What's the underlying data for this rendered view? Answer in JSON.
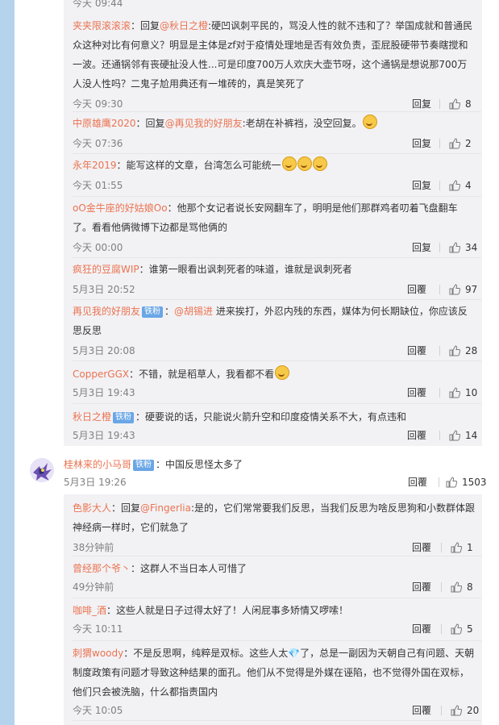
{
  "top_cut": {
    "time": "今天 09:44"
  },
  "comments": [
    {
      "user": "夹夹限滚滚滚",
      "prefix": "：回复",
      "mention": "@秋日之橙",
      "text": ":硬凹讽刺平民的，骂没人性的就不违和了？举国成就和普通民众这种对比有何意义？明显是主体是zf对于疫情处理地是否有效负责，歪屁股硬带节奏瞎搅和一波。还通锅邻有丧硬扯没人性...可是印度700万人欢庆大壶节呀，这个通锅是想说那700万人没人性吗？二鬼子尬用典还有一堆砖的，真是笑死了",
      "time": "今天 09:30",
      "reply_label": "回复",
      "likes": "8"
    },
    {
      "user": "中原雄鹰2020",
      "prefix": "：回复",
      "mention": "@再见我的好朋友",
      "text": ":老胡在补裤裆，没空回复。",
      "time": "今天 07:36",
      "reply_label": "回复",
      "likes": "2"
    },
    {
      "user": "永年2019",
      "text": "：能写这样的文章，台湾怎么可能统一",
      "time": "今天 01:55",
      "reply_label": "回复",
      "likes": "4"
    },
    {
      "user": "oO金牛座的好姑娘Oo",
      "text": "：他那个女记者说长安网翻车了，明明是他们那群鸡者叨着飞盘翻车了。看看他俩微博下边都是骂他俩的",
      "time": "今天 00:00",
      "reply_label": "回复",
      "likes": "34"
    },
    {
      "user": "疯狂的豆腐WIP",
      "text": "：谁第一眼看出讽刺死者的味道，谁就是讽刺死者",
      "time": "5月3日 20:52",
      "reply_label": "回覆",
      "likes": "97"
    },
    {
      "user": "再见我的好朋友",
      "tag": "铁粉",
      "prefix": "：",
      "mention": "@胡锡进",
      "text": " 进来挨打，外忍内残的东西，媒体为何长期缺位，你应该反思反思",
      "time": "5月3日 20:08",
      "reply_label": "回覆",
      "likes": "28"
    },
    {
      "user": "CopperGGX",
      "text": "：不错，就是稻草人，我看都不看",
      "time": "5月3日 19:43",
      "reply_label": "回覆",
      "likes": "10"
    },
    {
      "user": "秋日之橙",
      "tag": "铁粉",
      "text": "：硬要说的话，只能说火箭升空和印度疫情关系不大，有点违和",
      "time": "5月3日 19:43",
      "reply_label": "回覆",
      "likes": "14"
    }
  ],
  "main_comment": {
    "user": "桂林来的小马哥",
    "tag": "铁粉",
    "text": "：中国反思怪太多了",
    "time": "5月3日 19:26",
    "reply_label": "回覆",
    "likes": "1503"
  },
  "sub_comments": [
    {
      "user": "色影大人",
      "prefix": "：回复",
      "mention": "@Fingerlia",
      "text": ":是的，它们常常要我们反思，当我们反思为啥反思狗和小数群体跟神经病一样时，它们就急了",
      "time": "38分钟前",
      "reply_label": "回覆",
      "likes": "1"
    },
    {
      "user": "曾经那个爷丶",
      "text": "：这群人不当日本人可惜了",
      "time": "49分钟前",
      "reply_label": "回覆",
      "likes": "8"
    },
    {
      "user": "咖啡_酒",
      "text": "：这些人就是日子过得太好了！人闲屁事多矫情又啰嗦！",
      "time": "今天 10:11",
      "reply_label": "回覆",
      "likes": "5"
    },
    {
      "user": "刺猬woody",
      "text": "：不是反思啊，纯粹是双标。这些人太💎了，总是一副因为天朝自己有问题、天朝制度政策有问题才导致这种结果的面孔。他们从不觉得是外媒在诬陷，也不觉得外国在双标，他们只会被洗脑，什么都指责国内",
      "time": "今天 10:05",
      "reply_label": "回覆",
      "likes": "20"
    }
  ]
}
